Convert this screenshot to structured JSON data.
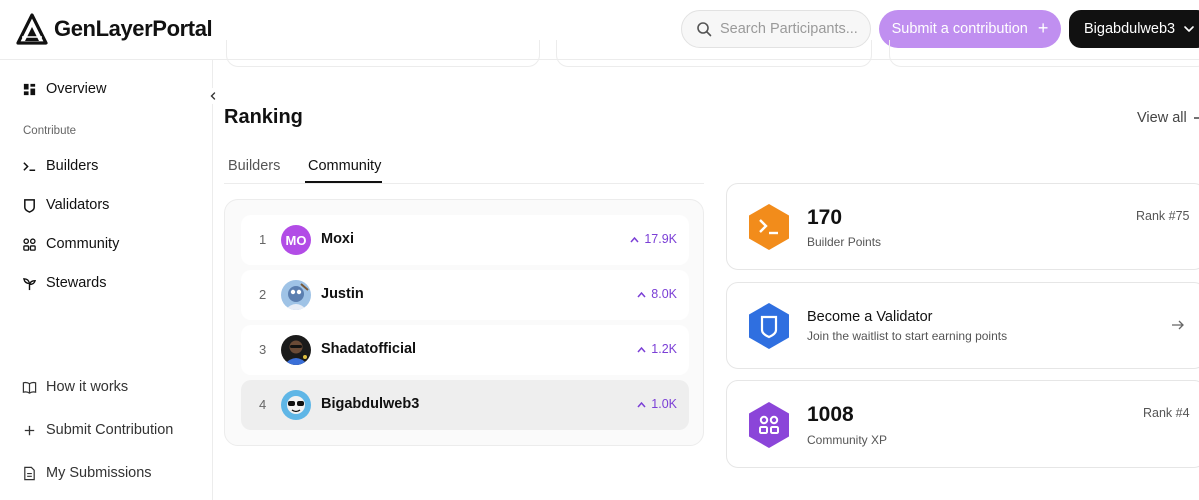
{
  "app": {
    "logo_text": "GenLayerPortal"
  },
  "header": {
    "search_placeholder": "Search Participants...",
    "submit_label": "Submit a contribution",
    "user_label": "Bigabdulweb3"
  },
  "sidebar": {
    "overview": "Overview",
    "section_label": "Contribute",
    "items": [
      {
        "label": "Builders",
        "icon": "terminal-icon"
      },
      {
        "label": "Validators",
        "icon": "shield-icon"
      },
      {
        "label": "Community",
        "icon": "community-grid-icon"
      },
      {
        "label": "Stewards",
        "icon": "sprout-icon"
      }
    ],
    "bottom": [
      {
        "label": "How it works",
        "icon": "book-icon"
      },
      {
        "label": "Submit Contribution",
        "icon": "plus-icon"
      },
      {
        "label": "My Submissions",
        "icon": "document-icon"
      }
    ]
  },
  "ranking": {
    "title": "Ranking",
    "view_all": "View all",
    "tabs": [
      "Builders",
      "Community"
    ],
    "active_tab": "Community",
    "rows": [
      {
        "rank": "1",
        "name": "Moxi",
        "score": "17.9K",
        "avatar": "MO"
      },
      {
        "rank": "2",
        "name": "Justin",
        "score": "8.0K"
      },
      {
        "rank": "3",
        "name": "Shadatofficial",
        "score": "1.2K"
      },
      {
        "rank": "4",
        "name": "Bigabdulweb3",
        "score": "1.0K"
      }
    ]
  },
  "stats": {
    "builder": {
      "value": "170",
      "label": "Builder Points",
      "rank": "Rank #75",
      "color": "#f28c1b"
    },
    "validator": {
      "title": "Become a Validator",
      "subtitle": "Join the waitlist to start earning points",
      "color": "#2f6fe0"
    },
    "community": {
      "value": "1008",
      "label": "Community XP",
      "rank": "Rank #4",
      "color": "#8b45d9"
    }
  },
  "colors": {
    "accent": "#c08ff0",
    "score": "#7b3fd6"
  }
}
